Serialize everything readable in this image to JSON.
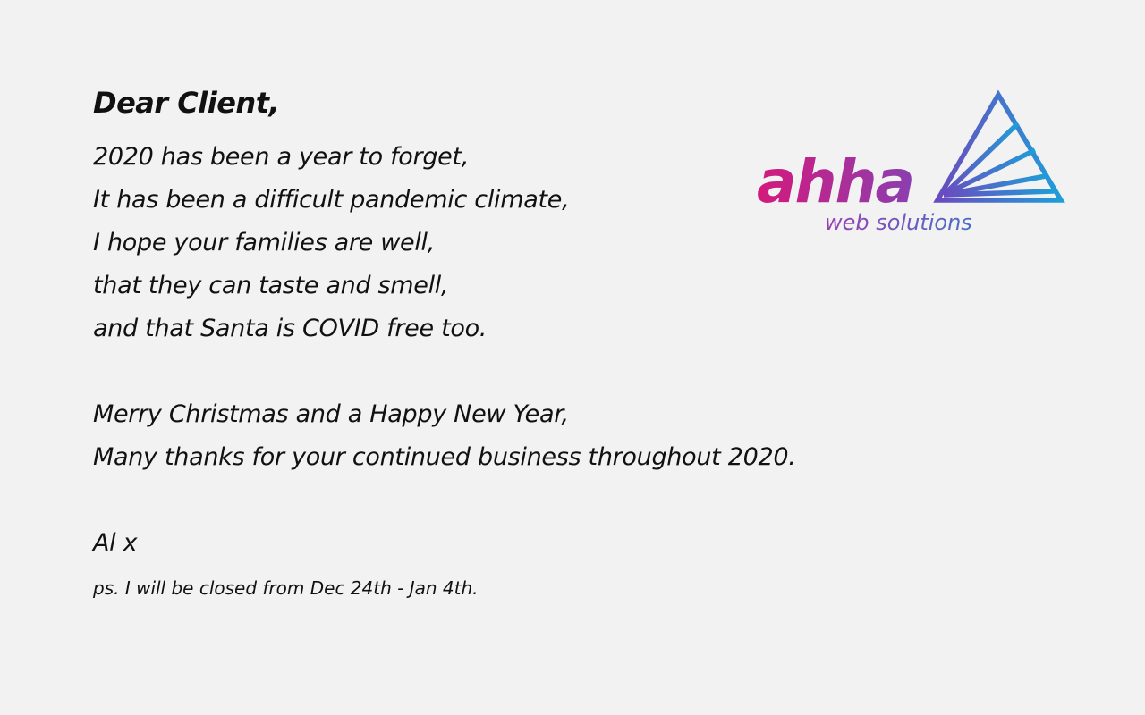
{
  "letter": {
    "greeting": "Dear Client,",
    "poem": [
      "2020 has been a year to forget,",
      "It has been a difficult pandemic climate,",
      "I hope your families are well,",
      "that they can taste and smell,",
      "and that Santa is COVID free too."
    ],
    "wishes": [
      "Merry Christmas and a Happy New Year,",
      "Many thanks for your continued business throughout 2020."
    ],
    "signoff": "Al x",
    "postscript": "ps. I will be closed from Dec 24th - Jan 4th."
  },
  "logo": {
    "wordmark": "ahha",
    "tagline": "web solutions",
    "colors": {
      "magenta": "#d4197c",
      "purple": "#8a3fb0",
      "blue": "#1f9ed8"
    }
  }
}
